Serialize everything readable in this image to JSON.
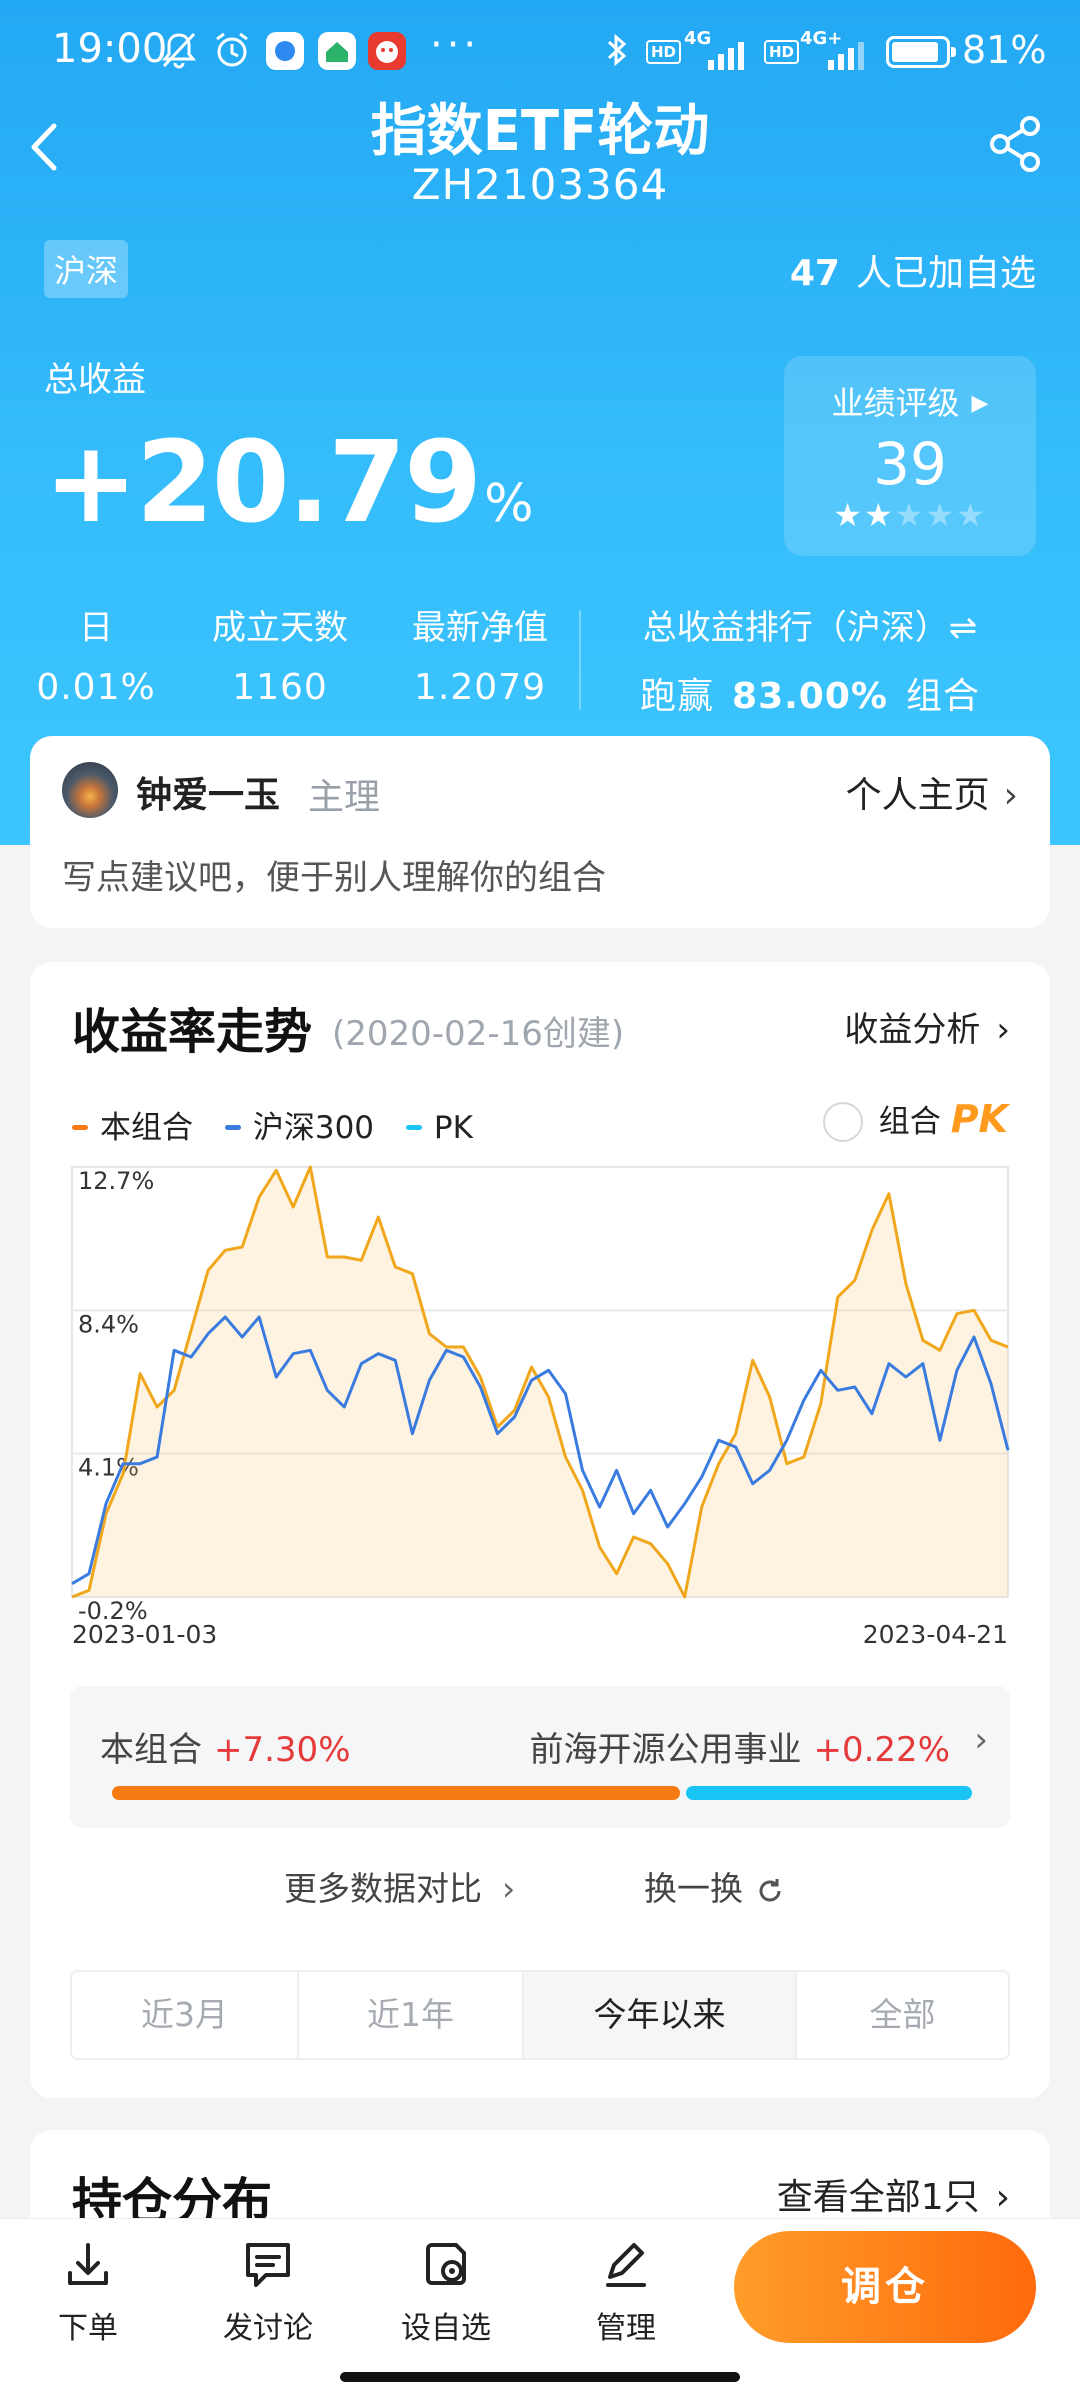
{
  "status_bar": {
    "time": "19:00",
    "net_1": "4G",
    "net_2": "4G+",
    "hd": "HD",
    "battery_pct": "81%",
    "battery_level": 0.81
  },
  "header": {
    "title": "指数ETF轮动",
    "code": "ZH2103364",
    "market_tag": "沪深",
    "followers_count": "47",
    "followers_label": "人已加自选"
  },
  "summary": {
    "total_label": "总收益",
    "total_value": "+20.79",
    "total_unit": "%",
    "rating_label": "业绩评级",
    "rating_score": "39",
    "rating_stars": 2,
    "rating_stars_max": 5,
    "metrics": [
      {
        "key": "日",
        "value": "0.01%"
      },
      {
        "key": "成立天数",
        "value": "1160"
      },
      {
        "key": "最新净值",
        "value": "1.2079"
      }
    ],
    "rank_label": "总收益排行（沪深）⇌",
    "rank_prefix": "跑赢",
    "rank_value": "83.00%",
    "rank_suffix": "组合"
  },
  "manager": {
    "name": "钟爱一玉",
    "role": "主理",
    "home_link": "个人主页",
    "tip": "写点建议吧，便于别人理解你的组合"
  },
  "chart_section": {
    "title": "收益率走势",
    "created": "(2020-02-16创建)",
    "link": "收益分析",
    "legend": [
      {
        "name": "本组合",
        "color": "#f57c14"
      },
      {
        "name": "沪深300",
        "color": "#3a7be0"
      },
      {
        "name": "PK",
        "color": "#1ac5f5"
      }
    ],
    "pk_label": "组合",
    "pk_badge": "PK",
    "compare": {
      "left_label": "本组合",
      "left_value": "+7.30%",
      "right_label": "前海开源公用事业",
      "right_value": "+0.22%",
      "left_share": 0.66
    },
    "more_label": "更多数据对比",
    "swap_label": "换一换",
    "tabs": [
      "近3月",
      "近1年",
      "今年以来",
      "全部"
    ],
    "active_tab": 2
  },
  "chart_data": {
    "type": "area",
    "x_start": "2023-01-03",
    "x_end": "2023-04-21",
    "yticks": [
      "12.7%",
      "8.4%",
      "4.1%",
      "-0.2%"
    ],
    "ylim": [
      -0.2,
      12.7
    ],
    "series": [
      {
        "name": "本组合",
        "color": "#f0a71c",
        "values": [
          -0.2,
          0.0,
          2.3,
          3.5,
          6.5,
          5.5,
          6.0,
          7.8,
          9.6,
          10.2,
          10.3,
          11.8,
          12.6,
          11.5,
          12.7,
          10.0,
          10.0,
          9.9,
          11.2,
          9.7,
          9.5,
          7.7,
          7.3,
          7.3,
          6.4,
          4.9,
          5.4,
          6.7,
          5.8,
          4.0,
          3.0,
          1.3,
          0.5,
          1.6,
          1.4,
          0.8,
          -0.2,
          2.5,
          3.8,
          4.7,
          6.9,
          5.8,
          3.8,
          4.0,
          5.6,
          8.8,
          9.3,
          10.8,
          11.9,
          9.2,
          7.5,
          7.2,
          8.3,
          8.4,
          7.5,
          7.3
        ]
      },
      {
        "name": "沪深300",
        "color": "#3a7be0",
        "values": [
          0.2,
          0.5,
          2.6,
          3.8,
          3.8,
          4.0,
          7.2,
          7.0,
          7.7,
          8.2,
          7.6,
          8.2,
          6.4,
          7.1,
          7.2,
          6.0,
          5.5,
          6.8,
          7.1,
          6.9,
          4.7,
          6.3,
          7.2,
          7.0,
          6.1,
          4.7,
          5.2,
          6.3,
          6.6,
          5.9,
          3.6,
          2.5,
          3.6,
          2.3,
          3.0,
          1.9,
          2.6,
          3.4,
          4.5,
          4.3,
          3.2,
          3.6,
          4.5,
          5.7,
          6.6,
          6.0,
          6.1,
          5.3,
          6.8,
          6.4,
          6.8,
          4.5,
          6.6,
          7.6,
          6.2,
          4.2
        ]
      }
    ],
    "grid": true
  },
  "holdings": {
    "title": "持仓分布",
    "link": "查看全部1只"
  },
  "bottom_bar": {
    "tools": [
      "下单",
      "发讨论",
      "设自选",
      "管理"
    ],
    "primary": "调仓"
  }
}
